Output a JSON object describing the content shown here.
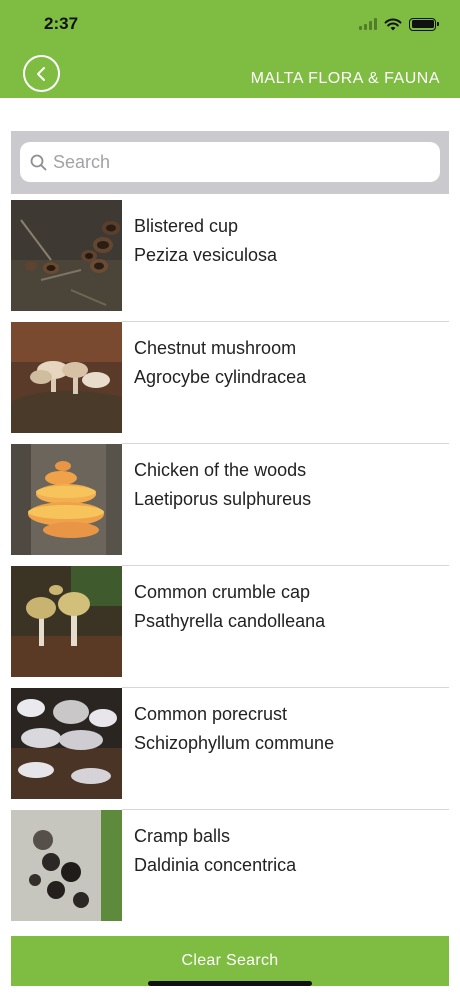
{
  "status_bar": {
    "time": "2:37"
  },
  "nav": {
    "title": "MALTA FLORA & FAUNA"
  },
  "search": {
    "placeholder": "Search",
    "value": ""
  },
  "items": [
    {
      "name": "Blistered cup",
      "latin": "Peziza vesiculosa"
    },
    {
      "name": "Chestnut mushroom",
      "latin": "Agrocybe cylindracea"
    },
    {
      "name": "Chicken of the woods",
      "latin": "Laetiporus sulphureus"
    },
    {
      "name": "Common crumble cap",
      "latin": "Psathyrella candolleana"
    },
    {
      "name": "Common porecrust",
      "latin": "Schizophyllum commune"
    },
    {
      "name": "Cramp balls",
      "latin": "Daldinia concentrica"
    }
  ],
  "clear_button": {
    "label": "Clear Search"
  },
  "colors": {
    "accent": "#7ebd42",
    "search_bar_bg": "#c9c9ce"
  },
  "icons": [
    "back-chevron-icon",
    "search-icon",
    "wifi-icon",
    "signal-icon",
    "battery-icon"
  ]
}
